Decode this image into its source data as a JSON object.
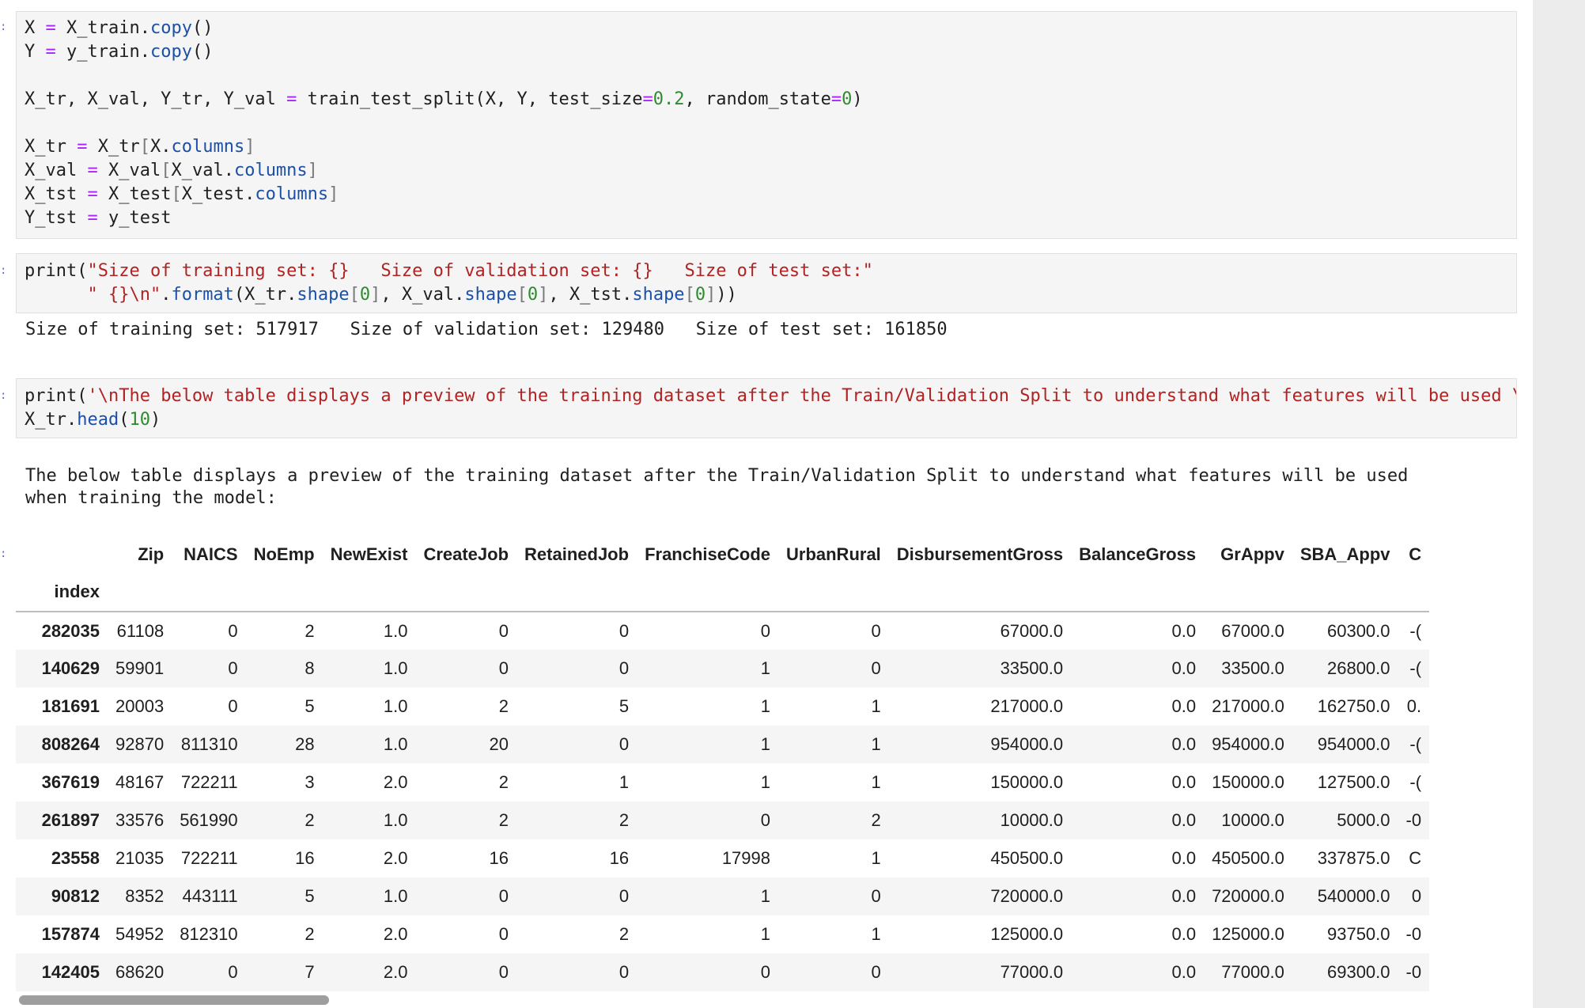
{
  "cells": {
    "split_cell": {
      "lines": [
        [
          {
            "t": "X ",
            "c": "var"
          },
          {
            "t": "=",
            "c": "op"
          },
          {
            "t": " X_train.",
            "c": "var"
          },
          {
            "t": "copy",
            "c": "attr"
          },
          {
            "t": "()",
            "c": "var"
          }
        ],
        [
          {
            "t": "Y ",
            "c": "var"
          },
          {
            "t": "=",
            "c": "op"
          },
          {
            "t": " y_train.",
            "c": "var"
          },
          {
            "t": "copy",
            "c": "attr"
          },
          {
            "t": "()",
            "c": "var"
          }
        ],
        [],
        [
          {
            "t": "X_tr, X_val, Y_tr, Y_val ",
            "c": "var"
          },
          {
            "t": "=",
            "c": "op"
          },
          {
            "t": " train_test_split(X, Y, test_size",
            "c": "var"
          },
          {
            "t": "=",
            "c": "op"
          },
          {
            "t": "0.2",
            "c": "num"
          },
          {
            "t": ", random_state",
            "c": "var"
          },
          {
            "t": "=",
            "c": "op"
          },
          {
            "t": "0",
            "c": "num"
          },
          {
            "t": ")",
            "c": "var"
          }
        ],
        [],
        [
          {
            "t": "X_tr ",
            "c": "var"
          },
          {
            "t": "=",
            "c": "op"
          },
          {
            "t": " X_tr",
            "c": "var"
          },
          {
            "t": "[",
            "c": "brk"
          },
          {
            "t": "X.",
            "c": "var"
          },
          {
            "t": "columns",
            "c": "attr"
          },
          {
            "t": "]",
            "c": "brk"
          }
        ],
        [
          {
            "t": "X_val ",
            "c": "var"
          },
          {
            "t": "=",
            "c": "op"
          },
          {
            "t": " X_val",
            "c": "var"
          },
          {
            "t": "[",
            "c": "brk"
          },
          {
            "t": "X_val.",
            "c": "var"
          },
          {
            "t": "columns",
            "c": "attr"
          },
          {
            "t": "]",
            "c": "brk"
          }
        ],
        [
          {
            "t": "X_tst ",
            "c": "var"
          },
          {
            "t": "=",
            "c": "op"
          },
          {
            "t": " X_test",
            "c": "var"
          },
          {
            "t": "[",
            "c": "brk"
          },
          {
            "t": "X_test.",
            "c": "var"
          },
          {
            "t": "columns",
            "c": "attr"
          },
          {
            "t": "]",
            "c": "brk"
          }
        ],
        [
          {
            "t": "Y_tst ",
            "c": "var"
          },
          {
            "t": "=",
            "c": "op"
          },
          {
            "t": " y_test",
            "c": "var"
          }
        ]
      ]
    },
    "print_cell": {
      "lines": [
        [
          {
            "t": "print(",
            "c": "var"
          },
          {
            "t": "\"Size of training set: {}   Size of validation set: {}   Size of test set:\"",
            "c": "str"
          }
        ],
        [
          {
            "t": "      ",
            "c": "var"
          },
          {
            "t": "\" {}\\n\"",
            "c": "str"
          },
          {
            "t": ".",
            "c": "var"
          },
          {
            "t": "format",
            "c": "attr"
          },
          {
            "t": "(X_tr.",
            "c": "var"
          },
          {
            "t": "shape",
            "c": "attr"
          },
          {
            "t": "[",
            "c": "brk"
          },
          {
            "t": "0",
            "c": "num"
          },
          {
            "t": "]",
            "c": "brk"
          },
          {
            "t": ", X_val.",
            "c": "var"
          },
          {
            "t": "shape",
            "c": "attr"
          },
          {
            "t": "[",
            "c": "brk"
          },
          {
            "t": "0",
            "c": "num"
          },
          {
            "t": "]",
            "c": "brk"
          },
          {
            "t": ", X_tst.",
            "c": "var"
          },
          {
            "t": "shape",
            "c": "attr"
          },
          {
            "t": "[",
            "c": "brk"
          },
          {
            "t": "0",
            "c": "num"
          },
          {
            "t": "]",
            "c": "brk"
          },
          {
            "t": "))",
            "c": "var"
          }
        ]
      ],
      "output": "Size of training set: 517917   Size of validation set: 129480   Size of test set: 161850"
    },
    "preview_cell": {
      "lines": [
        [
          {
            "t": "print(",
            "c": "var"
          },
          {
            "t": "'\\nThe below table displays a preview of the training dataset after the Train/Validation Split to understand what features will be used \\",
            "c": "str"
          }
        ],
        [
          {
            "t": "X_tr.",
            "c": "var"
          },
          {
            "t": "head",
            "c": "attr"
          },
          {
            "t": "(",
            "c": "var"
          },
          {
            "t": "10",
            "c": "num"
          },
          {
            "t": ")",
            "c": "var"
          }
        ]
      ],
      "output": "The below table displays a preview of the training dataset after the Train/Validation Split to understand what features will be used\nwhen training the model:"
    }
  },
  "table": {
    "index_label": "index",
    "columns": [
      "Zip",
      "NAICS",
      "NoEmp",
      "NewExist",
      "CreateJob",
      "RetainedJob",
      "FranchiseCode",
      "UrbanRural",
      "DisbursementGross",
      "BalanceGross",
      "GrAppv",
      "SBA_Appv",
      "C"
    ],
    "rows": [
      {
        "index": "282035",
        "cells": [
          "61108",
          "0",
          "2",
          "1.0",
          "0",
          "0",
          "0",
          "0",
          "67000.0",
          "0.0",
          "67000.0",
          "60300.0",
          "-("
        ]
      },
      {
        "index": "140629",
        "cells": [
          "59901",
          "0",
          "8",
          "1.0",
          "0",
          "0",
          "1",
          "0",
          "33500.0",
          "0.0",
          "33500.0",
          "26800.0",
          "-("
        ]
      },
      {
        "index": "181691",
        "cells": [
          "20003",
          "0",
          "5",
          "1.0",
          "2",
          "5",
          "1",
          "1",
          "217000.0",
          "0.0",
          "217000.0",
          "162750.0",
          "0."
        ]
      },
      {
        "index": "808264",
        "cells": [
          "92870",
          "811310",
          "28",
          "1.0",
          "20",
          "0",
          "1",
          "1",
          "954000.0",
          "0.0",
          "954000.0",
          "954000.0",
          "-("
        ]
      },
      {
        "index": "367619",
        "cells": [
          "48167",
          "722211",
          "3",
          "2.0",
          "2",
          "1",
          "1",
          "1",
          "150000.0",
          "0.0",
          "150000.0",
          "127500.0",
          "-("
        ]
      },
      {
        "index": "261897",
        "cells": [
          "33576",
          "561990",
          "2",
          "1.0",
          "2",
          "2",
          "0",
          "2",
          "10000.0",
          "0.0",
          "10000.0",
          "5000.0",
          "-0"
        ]
      },
      {
        "index": "23558",
        "cells": [
          "21035",
          "722211",
          "16",
          "2.0",
          "16",
          "16",
          "17998",
          "1",
          "450500.0",
          "0.0",
          "450500.0",
          "337875.0",
          "C"
        ]
      },
      {
        "index": "90812",
        "cells": [
          "8352",
          "443111",
          "5",
          "1.0",
          "0",
          "0",
          "1",
          "0",
          "720000.0",
          "0.0",
          "720000.0",
          "540000.0",
          "0"
        ]
      },
      {
        "index": "157874",
        "cells": [
          "54952",
          "812310",
          "2",
          "2.0",
          "0",
          "2",
          "1",
          "1",
          "125000.0",
          "0.0",
          "125000.0",
          "93750.0",
          "-0"
        ]
      },
      {
        "index": "142405",
        "cells": [
          "68620",
          "0",
          "7",
          "2.0",
          "0",
          "0",
          "0",
          "0",
          "77000.0",
          "0.0",
          "77000.0",
          "69300.0",
          "-0"
        ]
      }
    ]
  }
}
